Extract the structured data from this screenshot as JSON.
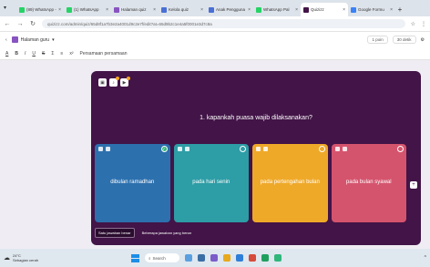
{
  "browser": {
    "tabs": [
      {
        "label": "(89) WhatsApp - ma",
        "color": "#25d366",
        "active": false
      },
      {
        "label": "(1) WhatsApp",
        "color": "#25d366",
        "active": false
      },
      {
        "label": "Halaman quiz",
        "color": "#8854c0",
        "active": false
      },
      {
        "label": "Kelola quiz",
        "color": "#4a6fd6",
        "active": false
      },
      {
        "label": "Anak Pengguna",
        "color": "#4a6fd6",
        "active": false
      },
      {
        "label": "WhatsApp Pal",
        "color": "#25d366",
        "active": false
      },
      {
        "label": "Quizizz",
        "color": "#421447",
        "active": true
      },
      {
        "label": "Google Formu",
        "color": "#3b82f6",
        "active": false
      }
    ],
    "new_tab_label": "+",
    "url": "quizizz.com/admin/quiz/65d8f1a7b3e2a4001d9c2e7f/edit?at=65d9b2c1e4a5f0001e3d7c8a"
  },
  "app": {
    "title": "Halaman guru",
    "privacy_label": "1 poin",
    "time_label": "30 detik"
  },
  "format_toolbar": {
    "items": [
      "A",
      "B",
      "I",
      "U",
      "S",
      "Σ",
      "≡",
      "x²"
    ],
    "equation_label": "Persamaan persamaan"
  },
  "question": {
    "text": "1. kapankah puasa wajib dilaksanakan?"
  },
  "options": [
    {
      "text": "dibulan ramadhan",
      "color": "#2d70ae",
      "correct": true
    },
    {
      "text": "pada hari senin",
      "color": "#2d9da6",
      "correct": false
    },
    {
      "text": "pada pertengahan bulan",
      "color": "#efa929",
      "correct": false
    },
    {
      "text": "pada bulan syawal",
      "color": "#d5546d",
      "correct": false
    }
  ],
  "answer_modes": {
    "single": "Satu jawaban benar",
    "multiple": "Beberapa jawaban yang benar"
  },
  "taskbar": {
    "weather_temp": "24°C",
    "weather_desc": "Sebagian cerah",
    "search_placeholder": "Search"
  }
}
